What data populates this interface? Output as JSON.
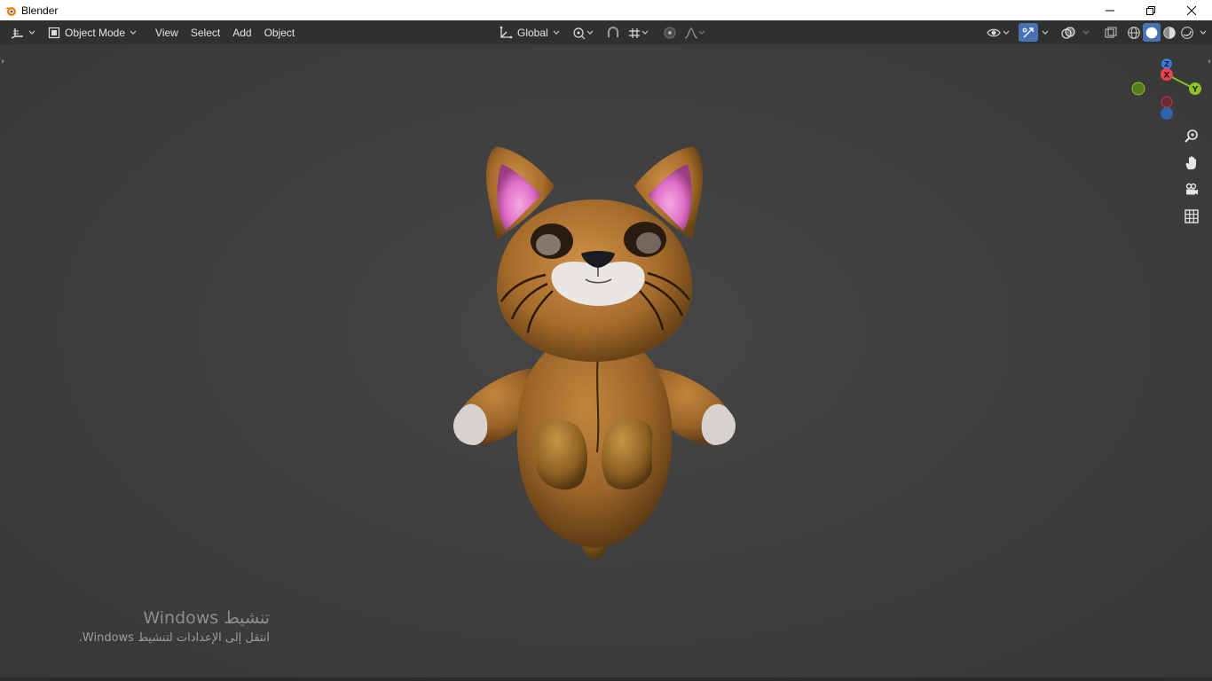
{
  "window": {
    "title": "Blender",
    "controls": [
      "minimize-icon",
      "restore-icon",
      "close-icon"
    ]
  },
  "header": {
    "editor_type_icon": "3d-viewport-icon",
    "mode": "Object Mode",
    "menus": [
      "View",
      "Select",
      "Add",
      "Object"
    ],
    "transform_orientation": "Global",
    "icons_center": [
      "pivot-point-icon",
      "snap-icon",
      "snap-increment-icon",
      "proportional-edit-icon",
      "falloff-icon"
    ],
    "icons_right": [
      "visibility-icon",
      "gizmo-toggle-icon",
      "overlay-icon",
      "xray-icon",
      "wireframe-shading-icon",
      "solid-shading-icon",
      "material-shading-icon",
      "rendered-shading-icon"
    ]
  },
  "viewport": {
    "gizmo": {
      "x_label": "X",
      "y_label": "Y",
      "z_label": "Z"
    },
    "nav_buttons": [
      "zoom-icon",
      "pan-hand-icon",
      "camera-view-icon",
      "ortho-grid-icon"
    ],
    "object": "plush cat model"
  },
  "activation_watermark": {
    "line1": "تنشيط Windows",
    "line2": "انتقل إلى الإعدادات لتنشيط Windows."
  },
  "colors": {
    "header_bg": "#303030",
    "viewport_bg": "#3f3f3f",
    "accent_blue": "#4772b3",
    "axis_x": "#e8434f",
    "axis_y": "#8bc424",
    "axis_z": "#3b7bd9"
  }
}
